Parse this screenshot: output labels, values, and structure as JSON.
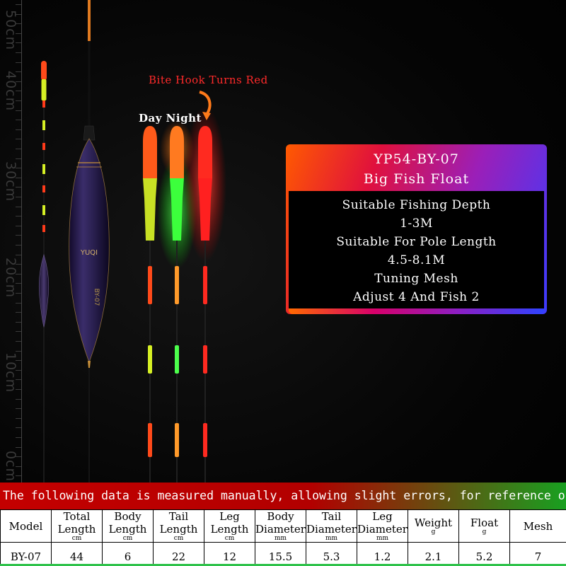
{
  "ruler": {
    "labels": [
      "50cm",
      "40cm",
      "30cm",
      "20cm",
      "10cm",
      "0cm"
    ]
  },
  "annotations": {
    "bite_text": "Bite Hook Turns Red",
    "day_night": "Day  Night",
    "bite_color": "#ff2a2a"
  },
  "float_markings": {
    "brand": "YUQI",
    "model_mark": "BY-07"
  },
  "panel": {
    "title": "YP54-BY-07",
    "subtitle": "Big Fish Float",
    "lines": [
      "Suitable Fishing Depth",
      "1-3M",
      "Suitable For Pole Length",
      "4.5-8.1M",
      "Tuning Mesh",
      "Adjust 4 And Fish 2"
    ]
  },
  "notice": "The following data is measured manually, allowing slight errors, for reference only",
  "table": {
    "headers": [
      {
        "label": "Model",
        "unit": ""
      },
      {
        "label": "Total Length",
        "unit": "cm"
      },
      {
        "label": "Body Length",
        "unit": "cm"
      },
      {
        "label": "Tail Length",
        "unit": "cm"
      },
      {
        "label": "Leg Length",
        "unit": "cm"
      },
      {
        "label": "Body Diameter",
        "unit": "mm"
      },
      {
        "label": "Tail Diameter",
        "unit": "mm"
      },
      {
        "label": "Leg Diameter",
        "unit": "mm"
      },
      {
        "label": "Weight",
        "unit": "g"
      },
      {
        "label": "Float",
        "unit": "g"
      },
      {
        "label": "Mesh",
        "unit": ""
      }
    ],
    "rows": [
      [
        "BY-07",
        "44",
        "6",
        "22",
        "12",
        "15.5",
        "5.3",
        "1.2",
        "2.1",
        "5.2",
        "7"
      ]
    ]
  },
  "colors": {
    "notice_red": "#c40000",
    "notice_green": "#18a020",
    "panel_gradient": [
      "#ff5a00",
      "#e0103d",
      "#9b1fb8",
      "#3c3cff"
    ],
    "day_tip": "#ff5a1a",
    "day_band": "#c8e024",
    "night_band": "#2cff2c",
    "bite_red": "#ff2020"
  }
}
